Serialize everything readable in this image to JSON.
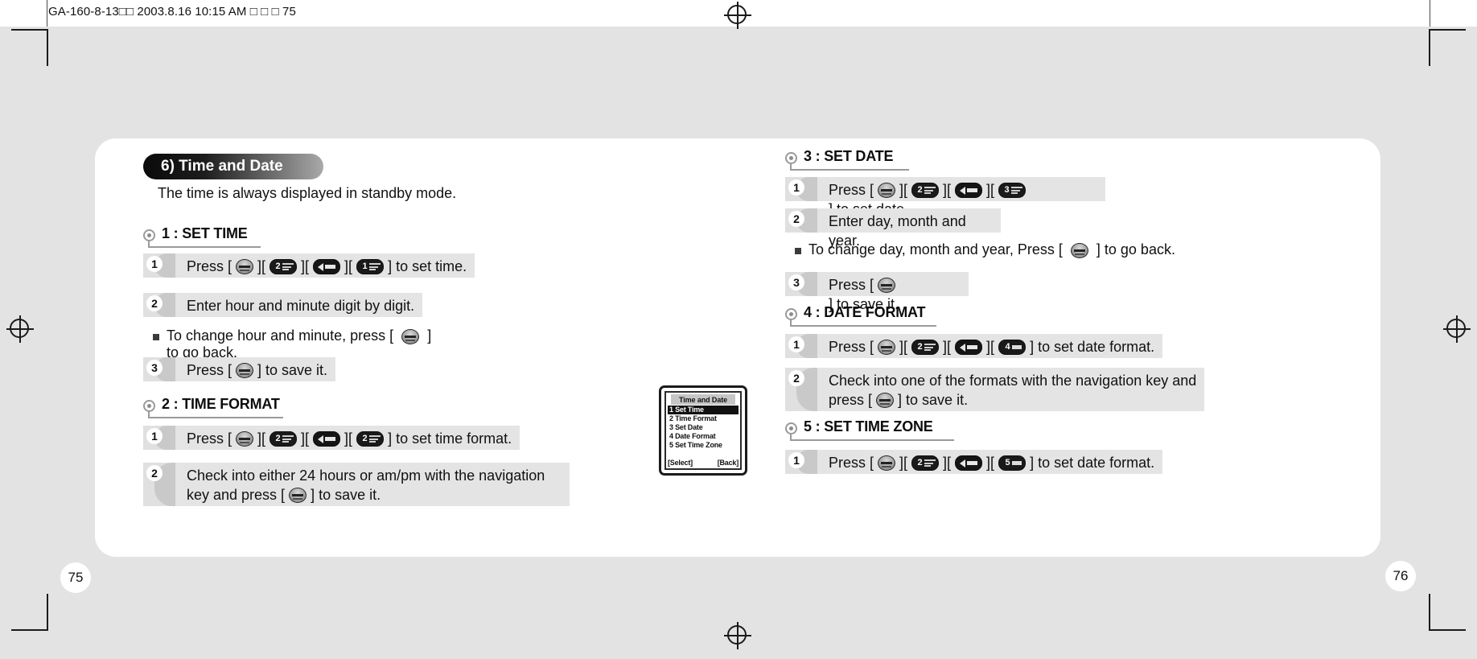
{
  "proof": {
    "header_text": "GA-160-8-13□□  2003.8.16 10:15 AM  □ □ □ 75",
    "page_left_number": "75",
    "page_right_number": "76"
  },
  "left_page": {
    "chapter_title": "6) Time and Date",
    "intro": "The time is always displayed in standby mode.",
    "sections": [
      {
        "title": "1 : SET TIME",
        "steps": [
          {
            "number": "1",
            "lines": [
              {
                "pre": "Press [",
                "keys": [
                  "ok",
                  "2",
                  "nav",
                  "1"
                ],
                "post": "] to set time."
              }
            ]
          },
          {
            "number": "2",
            "lines": [
              {
                "pre": "Enter hour and minute digit by digit.",
                "keys": [],
                "post": ""
              }
            ]
          }
        ],
        "note": {
          "line1_pre": "To change hour and minute, press [",
          "line1_post": "]",
          "line2": "to go back."
        },
        "final_step": {
          "number": "3",
          "pre": "Press [",
          "post": "] to save it."
        }
      },
      {
        "title": "2 : TIME FORMAT",
        "steps": [
          {
            "number": "1",
            "lines": [
              {
                "pre": "Press [",
                "keys": [
                  "ok",
                  "2",
                  "nav",
                  "2"
                ],
                "post": "] to set time format."
              }
            ]
          },
          {
            "number": "2",
            "line1": "Check into either 24 hours or am/pm with the navigation",
            "line2_pre": "key and press [",
            "line2_post": "] to save it."
          }
        ]
      }
    ],
    "handset": {
      "title": "Time and Date",
      "items": [
        "1 Set Time",
        "2 Time Format",
        "3 Set Date",
        "4 Date Format",
        "5 Set Time Zone"
      ],
      "selected_index": 0,
      "softkey_left": "[Select]",
      "softkey_right": "[Back]"
    }
  },
  "right_page": {
    "sections": [
      {
        "title": "3 : SET DATE",
        "steps": [
          {
            "number": "1",
            "lines": [
              {
                "pre": "Press [",
                "keys": [
                  "ok",
                  "2",
                  "nav",
                  "3"
                ],
                "post": "] to set date."
              }
            ]
          },
          {
            "number": "2",
            "lines": [
              {
                "pre": "Enter day, month and year.",
                "keys": [],
                "post": ""
              }
            ]
          }
        ],
        "note": {
          "line1_pre": "To change day, month and year, Press [",
          "line1_post": "] to go back."
        },
        "final_step": {
          "number": "3",
          "pre": "Press [",
          "post": "] to save it."
        }
      },
      {
        "title": "4 : DATE FORMAT",
        "steps": [
          {
            "number": "1",
            "lines": [
              {
                "pre": "Press [",
                "keys": [
                  "ok",
                  "2",
                  "nav",
                  "4"
                ],
                "post": "] to set date format."
              }
            ]
          },
          {
            "number": "2",
            "line1": "Check into one of the formats with the navigation key and",
            "line2_pre": "press [",
            "line2_post": "] to save it."
          }
        ]
      },
      {
        "title": "5 : SET TIME ZONE",
        "steps": [
          {
            "number": "1",
            "lines": [
              {
                "pre": "Press [",
                "keys": [
                  "ok",
                  "2",
                  "nav",
                  "5"
                ],
                "post": "] to set date format."
              }
            ]
          }
        ]
      }
    ]
  },
  "colors": {
    "page_bg": "#e3e3e3",
    "paper": "#ffffff",
    "band": "#e4e4e4",
    "badge_swoosh": "#c9c9c9",
    "rule": "#9a9a9a",
    "ink": "#111111"
  }
}
